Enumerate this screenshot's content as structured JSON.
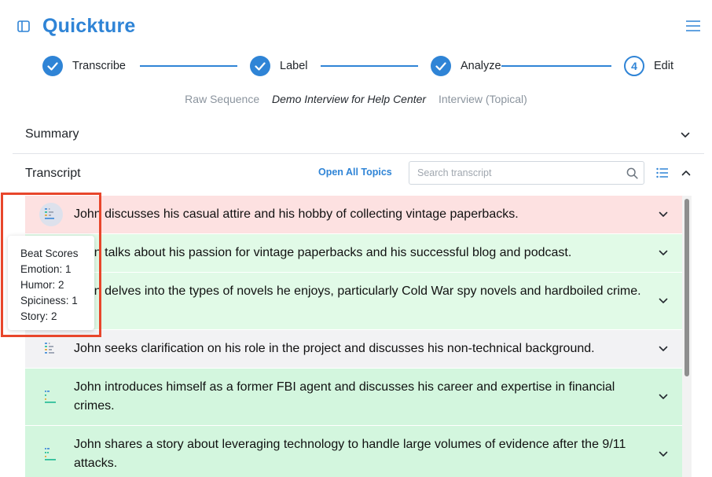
{
  "app": {
    "title": "Quickture"
  },
  "colors": {
    "accent": "#2f84d6",
    "row_red": "#fde1e1",
    "row_green": "#e1fae7",
    "row_green_strong": "#d3f6de",
    "row_gray": "#f2f2f4",
    "highlight": "#e8462b"
  },
  "stepper": {
    "steps": [
      {
        "label": "Transcribe",
        "status": "done"
      },
      {
        "label": "Label",
        "status": "done"
      },
      {
        "label": "Analyze",
        "status": "done"
      },
      {
        "label": "Edit",
        "status": "current",
        "number": "4"
      }
    ]
  },
  "breadcrumb": {
    "items": [
      "Raw Sequence",
      "Demo Interview for Help Center",
      "Interview (Topical)"
    ]
  },
  "summary": {
    "title": "Summary"
  },
  "transcript": {
    "title": "Transcript",
    "open_all_label": "Open All Topics",
    "search_placeholder": "Search transcript",
    "topics": [
      {
        "text": "John discusses his casual attire and his hobby of collecting vintage paperbacks.",
        "bg": "#fde1e1"
      },
      {
        "text": "John talks about his passion for vintage paperbacks and his successful blog and podcast.",
        "bg": "#e1fae7"
      },
      {
        "text": "John delves into the types of novels he enjoys, particularly Cold War spy novels and hardboiled crime.",
        "bg": "#e1fae7"
      },
      {
        "text": "John seeks clarification on his role in the project and discusses his non-technical background.",
        "bg": "#f2f2f4"
      },
      {
        "text": "John introduces himself as a former FBI agent and discusses his career and expertise in financial crimes.",
        "bg": "#d3f6de"
      },
      {
        "text": "John shares a story about leveraging technology to handle large volumes of evidence after the 9/11 attacks.",
        "bg": "#d3f6de"
      }
    ]
  },
  "tooltip": {
    "title": "Beat Scores",
    "lines": [
      "Emotion: 1",
      "Humor: 2",
      "Spiciness: 1",
      "Story: 2"
    ]
  }
}
